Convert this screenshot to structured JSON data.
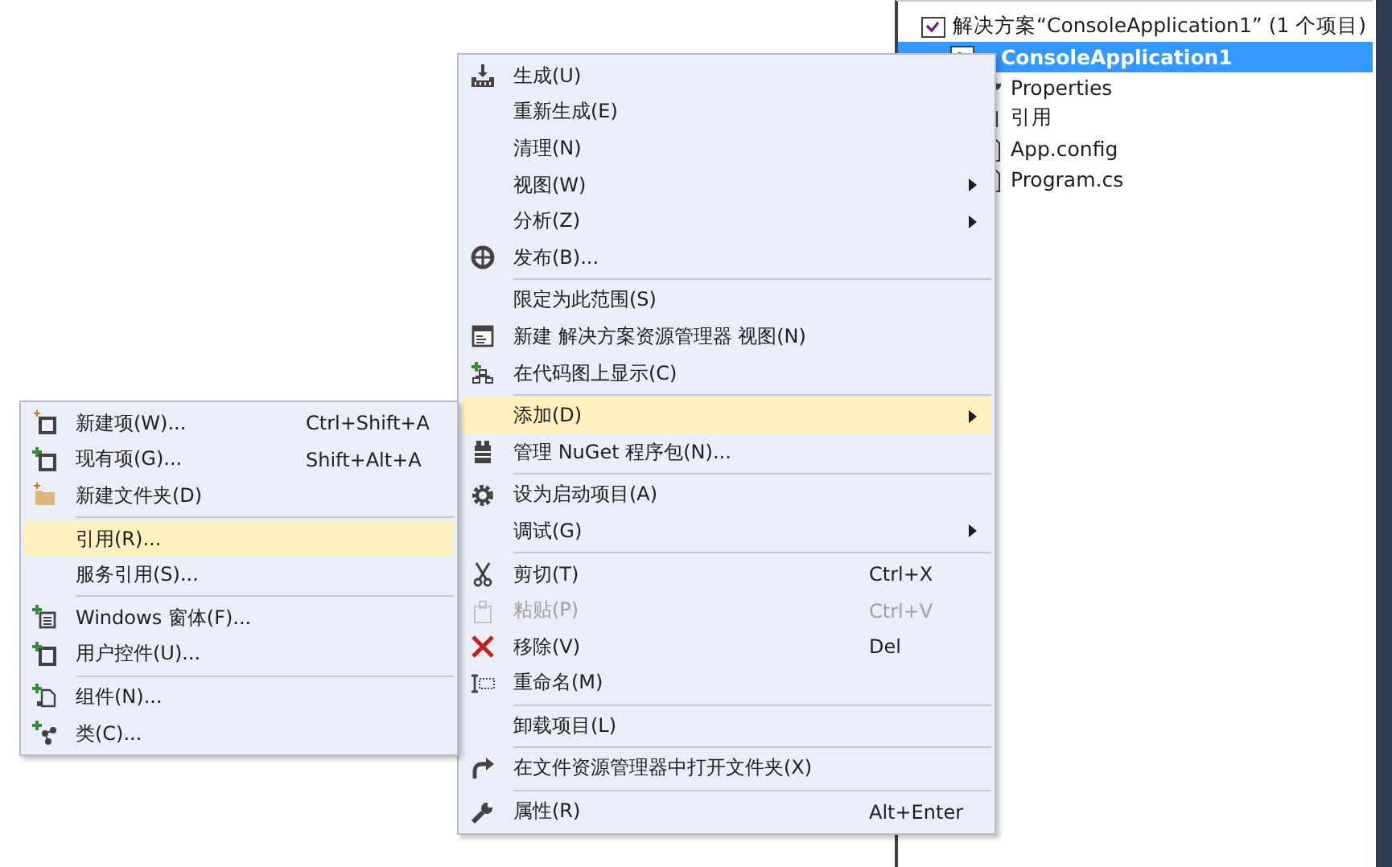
{
  "solution_explorer": {
    "items": [
      {
        "label": "解决方案“ConsoleApplication1” (1 个项目)",
        "selected": false,
        "children": [
          {
            "label": "ConsoleApplication1",
            "selected": true,
            "children": [
              {
                "label": "Properties",
                "selected": false
              },
              {
                "label": "引用",
                "selected": false
              },
              {
                "label": "App.config",
                "selected": false
              },
              {
                "label": "Program.cs",
                "selected": false
              }
            ]
          }
        ]
      }
    ]
  },
  "context_menu": {
    "items": [
      {
        "kind": "item",
        "label": "生成(U)",
        "selected": false,
        "disabled": false,
        "submenu": false
      },
      {
        "kind": "item",
        "label": "重新生成(E)",
        "selected": false,
        "disabled": false,
        "submenu": false
      },
      {
        "kind": "item",
        "label": "清理(N)",
        "selected": false,
        "disabled": false,
        "submenu": false
      },
      {
        "kind": "item",
        "label": "视图(W)",
        "selected": false,
        "disabled": false,
        "submenu": true
      },
      {
        "kind": "item",
        "label": "分析(Z)",
        "selected": false,
        "disabled": false,
        "submenu": true
      },
      {
        "kind": "item",
        "label": "发布(B)...",
        "selected": false,
        "disabled": false,
        "submenu": false
      },
      {
        "kind": "separator"
      },
      {
        "kind": "item",
        "label": "限定为此范围(S)",
        "selected": false,
        "disabled": false,
        "submenu": false
      },
      {
        "kind": "item",
        "label": "新建 解决方案资源管理器 视图(N)",
        "selected": false,
        "disabled": false,
        "submenu": false
      },
      {
        "kind": "item",
        "label": "在代码图上显示(C)",
        "selected": false,
        "disabled": false,
        "submenu": false
      },
      {
        "kind": "separator"
      },
      {
        "kind": "item",
        "label": "添加(D)",
        "selected": true,
        "disabled": false,
        "submenu": true
      },
      {
        "kind": "item",
        "label": "管理 NuGet 程序包(N)...",
        "selected": false,
        "disabled": false,
        "submenu": false
      },
      {
        "kind": "separator"
      },
      {
        "kind": "item",
        "label": "设为启动项目(A)",
        "selected": false,
        "disabled": false,
        "submenu": false
      },
      {
        "kind": "item",
        "label": "调试(G)",
        "selected": false,
        "disabled": false,
        "submenu": true
      },
      {
        "kind": "separator"
      },
      {
        "kind": "item",
        "label": "剪切(T)",
        "shortcut": "Ctrl+X",
        "selected": false,
        "disabled": false,
        "submenu": false
      },
      {
        "kind": "item",
        "label": "粘贴(P)",
        "shortcut": "Ctrl+V",
        "selected": false,
        "disabled": true,
        "submenu": false
      },
      {
        "kind": "item",
        "label": "移除(V)",
        "shortcut": "Del",
        "selected": false,
        "disabled": false,
        "submenu": false
      },
      {
        "kind": "item",
        "label": "重命名(M)",
        "selected": false,
        "disabled": false,
        "submenu": false
      },
      {
        "kind": "separator"
      },
      {
        "kind": "item",
        "label": "卸载项目(L)",
        "selected": false,
        "disabled": false,
        "submenu": false
      },
      {
        "kind": "separator"
      },
      {
        "kind": "item",
        "label": "在文件资源管理器中打开文件夹(X)",
        "selected": false,
        "disabled": false,
        "submenu": false
      },
      {
        "kind": "separator"
      },
      {
        "kind": "item",
        "label": "属性(R)",
        "shortcut": "Alt+Enter",
        "selected": false,
        "disabled": false,
        "submenu": false
      }
    ]
  },
  "add_submenu": {
    "items": [
      {
        "kind": "item",
        "label": "新建项(W)...",
        "shortcut": "Ctrl+Shift+A",
        "selected": false,
        "disabled": false,
        "submenu": false
      },
      {
        "kind": "item",
        "label": "现有项(G)...",
        "shortcut": "Shift+Alt+A",
        "selected": false,
        "disabled": false,
        "submenu": false
      },
      {
        "kind": "item",
        "label": "新建文件夹(D)",
        "selected": false,
        "disabled": false,
        "submenu": false
      },
      {
        "kind": "separator"
      },
      {
        "kind": "item",
        "label": "引用(R)...",
        "selected": true,
        "disabled": false,
        "submenu": false
      },
      {
        "kind": "item",
        "label": "服务引用(S)...",
        "selected": false,
        "disabled": false,
        "submenu": false
      },
      {
        "kind": "separator"
      },
      {
        "kind": "item",
        "label": "Windows 窗体(F)...",
        "selected": false,
        "disabled": false,
        "submenu": false
      },
      {
        "kind": "item",
        "label": "用户控件(U)...",
        "selected": false,
        "disabled": false,
        "submenu": false
      },
      {
        "kind": "separator"
      },
      {
        "kind": "item",
        "label": "组件(N)...",
        "selected": false,
        "disabled": false,
        "submenu": false
      },
      {
        "kind": "item",
        "label": "类(C)...",
        "selected": false,
        "disabled": false,
        "submenu": false
      }
    ]
  }
}
